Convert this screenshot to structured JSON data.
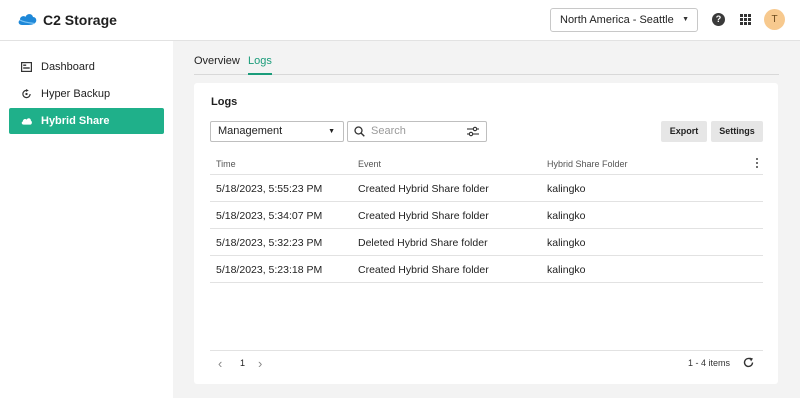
{
  "header": {
    "app_title": "C2 Storage",
    "region": "North America - Seattle",
    "avatar_initial": "T"
  },
  "sidebar": {
    "items": [
      {
        "label": "Dashboard",
        "icon": "dashboard-icon",
        "active": false
      },
      {
        "label": "Hyper Backup",
        "icon": "hyper-backup-icon",
        "active": false
      },
      {
        "label": "Hybrid Share",
        "icon": "cloud-icon",
        "active": true
      }
    ]
  },
  "tabs": [
    {
      "label": "Overview",
      "active": false
    },
    {
      "label": "Logs",
      "active": true
    }
  ],
  "card": {
    "title": "Logs",
    "scope": "Management",
    "search_placeholder": "Search",
    "export_label": "Export",
    "settings_label": "Settings"
  },
  "table": {
    "columns": [
      "Time",
      "Event",
      "Hybrid Share Folder"
    ],
    "rows": [
      [
        "5/18/2023, 5:55:23 PM",
        "Created Hybrid Share folder",
        "kalingko"
      ],
      [
        "5/18/2023, 5:34:07 PM",
        "Created Hybrid Share folder",
        "kalingko"
      ],
      [
        "5/18/2023, 5:32:23 PM",
        "Deleted Hybrid Share folder",
        "kalingko"
      ],
      [
        "5/18/2023, 5:23:18 PM",
        "Created Hybrid Share folder",
        "kalingko"
      ]
    ]
  },
  "pagination": {
    "page": "1",
    "count": "1 - 4 items"
  },
  "colors": {
    "accent": "#1fb08a",
    "tab_active": "#1a9c7a",
    "logo": "#1e88d8"
  }
}
